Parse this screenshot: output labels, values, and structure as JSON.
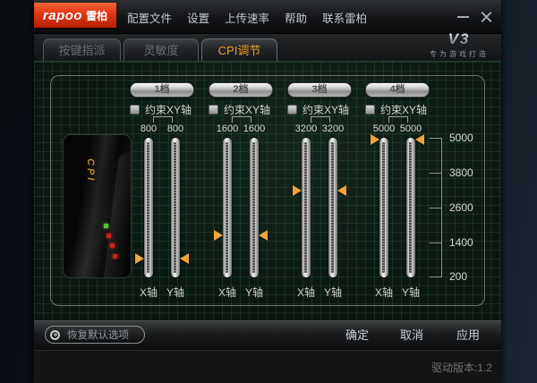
{
  "window": {
    "brand": "rapoo",
    "brand_cn": "雷柏",
    "menu": [
      "配置文件",
      "设置",
      "上传速率",
      "帮助",
      "联系雷柏"
    ]
  },
  "tabs": [
    {
      "label": "按键指派",
      "active": false
    },
    {
      "label": "灵敏度",
      "active": false
    },
    {
      "label": "CPI调节",
      "active": true
    }
  ],
  "badge": {
    "model": "V3",
    "slogan": "专为游戏打造"
  },
  "mouse_image": {
    "label": "CPI"
  },
  "cpi": {
    "range_min": 200,
    "range_max": 5000,
    "scale_ticks": [
      "5000",
      "3800",
      "2600",
      "1400",
      "200"
    ],
    "panels": [
      {
        "gear": "1档",
        "constrain_label": "约束XY轴",
        "constrained": false,
        "x_value": 800,
        "y_value": 800,
        "x_axis": "X轴",
        "y_axis": "Y轴"
      },
      {
        "gear": "2档",
        "constrain_label": "约束XY轴",
        "constrained": false,
        "x_value": 1600,
        "y_value": 1600,
        "x_axis": "X轴",
        "y_axis": "Y轴"
      },
      {
        "gear": "3档",
        "constrain_label": "约束XY轴",
        "constrained": false,
        "x_value": 3200,
        "y_value": 3200,
        "x_axis": "X轴",
        "y_axis": "Y轴"
      },
      {
        "gear": "4档",
        "constrain_label": "约束XY轴",
        "constrained": false,
        "x_value": 5000,
        "y_value": 5000,
        "x_axis": "X轴",
        "y_axis": "Y轴"
      }
    ]
  },
  "footer": {
    "restore": "恢复默认选项",
    "ok": "确定",
    "cancel": "取消",
    "apply": "应用"
  },
  "status": {
    "version": "驱动版本:1.2"
  },
  "colors": {
    "accent_orange": "#f09f28",
    "marker": "#f2a33c",
    "led_green": "#58c032",
    "led_red": "#cc2418",
    "grid_green": "#34624a"
  }
}
